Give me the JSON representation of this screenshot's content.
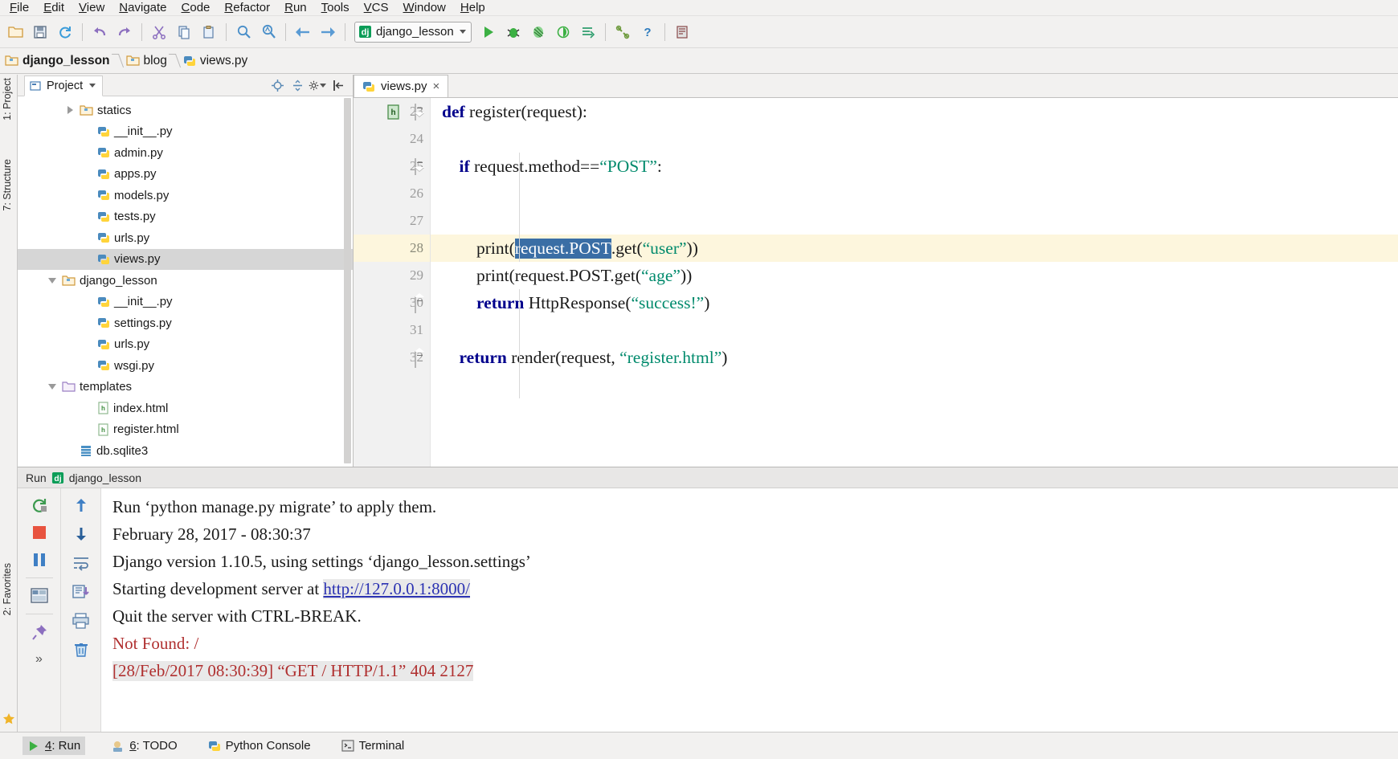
{
  "menu": {
    "items": [
      "File",
      "Edit",
      "View",
      "Navigate",
      "Code",
      "Refactor",
      "Run",
      "Tools",
      "VCS",
      "Window",
      "Help"
    ]
  },
  "toolbar": {
    "buttons": [
      {
        "name": "open-folder-icon",
        "label": "Open"
      },
      {
        "name": "save-all-icon",
        "label": "Save All"
      },
      {
        "name": "sync-icon",
        "label": "Synchronize"
      },
      {
        "name": "undo-icon",
        "label": "Undo"
      },
      {
        "name": "redo-icon",
        "label": "Redo"
      },
      {
        "name": "cut-icon",
        "label": "Cut"
      },
      {
        "name": "copy-icon",
        "label": "Copy"
      },
      {
        "name": "paste-icon",
        "label": "Paste"
      },
      {
        "name": "find-icon",
        "label": "Find"
      },
      {
        "name": "replace-icon",
        "label": "Replace"
      },
      {
        "name": "back-arrow-icon",
        "label": "Back"
      },
      {
        "name": "forward-arrow-icon",
        "label": "Forward"
      }
    ],
    "run_config": "django_lesson",
    "right_buttons": [
      {
        "name": "run-icon",
        "label": "Run"
      },
      {
        "name": "debug-icon",
        "label": "Debug"
      },
      {
        "name": "coverage-icon",
        "label": "Run with Coverage"
      },
      {
        "name": "profile-icon",
        "label": "Profile"
      },
      {
        "name": "attach-icon",
        "label": "Attach to Process"
      },
      {
        "name": "settings-wrench-icon",
        "label": "Settings"
      },
      {
        "name": "help-icon",
        "label": "Help"
      },
      {
        "name": "database-icon",
        "label": "Database"
      }
    ]
  },
  "breadcrumb": {
    "items": [
      {
        "label": "django_lesson",
        "icon": "folder-icon",
        "bold": true
      },
      {
        "label": "blog",
        "icon": "folder-icon",
        "bold": false
      },
      {
        "label": "views.py",
        "icon": "python-file-icon",
        "bold": false
      }
    ]
  },
  "left_rail": {
    "project_label": "1: Project",
    "structure_label": "7: Structure",
    "favorites_label": "2: Favorites"
  },
  "project_panel": {
    "title": "Project",
    "actions": [
      {
        "name": "locate-icon",
        "label": "Select Opened File"
      },
      {
        "name": "collapse-all-icon",
        "label": "Collapse All"
      },
      {
        "name": "gear-icon",
        "label": "Settings"
      },
      {
        "name": "hide-icon",
        "label": "Hide"
      }
    ],
    "tree": [
      {
        "label": "statics",
        "icon": "folder-icon",
        "indent": 2,
        "arrow": "right",
        "selected": false
      },
      {
        "label": "__init__.py",
        "icon": "python-file-icon",
        "indent": 3,
        "arrow": "none",
        "selected": false
      },
      {
        "label": "admin.py",
        "icon": "python-file-icon",
        "indent": 3,
        "arrow": "none",
        "selected": false
      },
      {
        "label": "apps.py",
        "icon": "python-file-icon",
        "indent": 3,
        "arrow": "none",
        "selected": false
      },
      {
        "label": "models.py",
        "icon": "python-file-icon",
        "indent": 3,
        "arrow": "none",
        "selected": false
      },
      {
        "label": "tests.py",
        "icon": "python-file-icon",
        "indent": 3,
        "arrow": "none",
        "selected": false
      },
      {
        "label": "urls.py",
        "icon": "python-file-icon",
        "indent": 3,
        "arrow": "none",
        "selected": false
      },
      {
        "label": "views.py",
        "icon": "python-file-icon",
        "indent": 3,
        "arrow": "none",
        "selected": true
      },
      {
        "label": "django_lesson",
        "icon": "folder-icon",
        "indent": 1,
        "arrow": "down",
        "selected": false
      },
      {
        "label": "__init__.py",
        "icon": "python-file-icon",
        "indent": 3,
        "arrow": "none",
        "selected": false
      },
      {
        "label": "settings.py",
        "icon": "python-file-icon",
        "indent": 3,
        "arrow": "none",
        "selected": false
      },
      {
        "label": "urls.py",
        "icon": "python-file-icon",
        "indent": 3,
        "arrow": "none",
        "selected": false
      },
      {
        "label": "wsgi.py",
        "icon": "python-file-icon",
        "indent": 3,
        "arrow": "none",
        "selected": false
      },
      {
        "label": "templates",
        "icon": "folder-plain-icon",
        "indent": 1,
        "arrow": "down",
        "selected": false
      },
      {
        "label": "index.html",
        "icon": "html-file-icon",
        "indent": 3,
        "arrow": "none",
        "selected": false
      },
      {
        "label": "register.html",
        "icon": "html-file-icon",
        "indent": 3,
        "arrow": "none",
        "selected": false
      },
      {
        "label": "db.sqlite3",
        "icon": "database-file-icon",
        "indent": 2,
        "arrow": "none",
        "selected": false
      }
    ]
  },
  "editor": {
    "tab": {
      "label": "views.py",
      "icon": "python-file-icon",
      "close": "×"
    },
    "lines": [
      {
        "num": "23",
        "fold": "open",
        "icon": "html-gutter-icon",
        "current": false,
        "tokens": [
          {
            "t": "def ",
            "c": "kw"
          },
          {
            "t": "register",
            "c": "fn"
          },
          {
            "t": "(request):",
            "c": "plain"
          }
        ]
      },
      {
        "num": "24",
        "fold": "none",
        "icon": "none",
        "current": false,
        "tokens": []
      },
      {
        "num": "25",
        "fold": "open",
        "icon": "none",
        "current": false,
        "tokens": [
          {
            "t": "    ",
            "c": "plain"
          },
          {
            "t": "if ",
            "c": "kw"
          },
          {
            "t": "request.method==",
            "c": "plain"
          },
          {
            "t": "“POST”",
            "c": "str"
          },
          {
            "t": ":",
            "c": "plain"
          }
        ]
      },
      {
        "num": "26",
        "fold": "none",
        "icon": "none",
        "current": false,
        "tokens": []
      },
      {
        "num": "27",
        "fold": "none",
        "icon": "none",
        "current": false,
        "tokens": []
      },
      {
        "num": "28",
        "fold": "none",
        "icon": "none",
        "current": true,
        "tokens": [
          {
            "t": "        print(",
            "c": "plain"
          },
          {
            "t": "request.POST",
            "c": "sel"
          },
          {
            "t": ".get(",
            "c": "plain"
          },
          {
            "t": "“user”",
            "c": "str"
          },
          {
            "t": "))",
            "c": "plain"
          }
        ]
      },
      {
        "num": "29",
        "fold": "none",
        "icon": "none",
        "current": false,
        "tokens": [
          {
            "t": "        print(request.POST.get(",
            "c": "plain"
          },
          {
            "t": "“age”",
            "c": "str"
          },
          {
            "t": "))",
            "c": "plain"
          }
        ]
      },
      {
        "num": "30",
        "fold": "end",
        "icon": "none",
        "current": false,
        "tokens": [
          {
            "t": "        ",
            "c": "plain"
          },
          {
            "t": "return ",
            "c": "kw"
          },
          {
            "t": "HttpResponse(",
            "c": "plain"
          },
          {
            "t": "“success!”",
            "c": "str"
          },
          {
            "t": ")",
            "c": "plain"
          }
        ]
      },
      {
        "num": "31",
        "fold": "none",
        "icon": "none",
        "current": false,
        "tokens": []
      },
      {
        "num": "32",
        "fold": "end",
        "icon": "none",
        "current": false,
        "tokens": [
          {
            "t": "    ",
            "c": "plain"
          },
          {
            "t": "return ",
            "c": "kw"
          },
          {
            "t": "render(request, ",
            "c": "plain"
          },
          {
            "t": "“register.html”",
            "c": "str"
          },
          {
            "t": ")",
            "c": "plain"
          }
        ]
      }
    ]
  },
  "run_panel": {
    "header_prefix": "Run",
    "header_config": "django_lesson",
    "tools_left": [
      {
        "name": "rerun-icon",
        "label": "Rerun"
      },
      {
        "name": "stop-icon",
        "label": "Stop"
      },
      {
        "name": "pause-icon",
        "label": "Pause Output"
      },
      {
        "name": "layout-icon",
        "label": "Layout"
      },
      {
        "name": "pin-icon",
        "label": "Pin Tab"
      },
      {
        "name": "more-icon",
        "label": "»"
      }
    ],
    "tools_right": [
      {
        "name": "arrow-up-icon",
        "label": "Up the Stack Trace"
      },
      {
        "name": "arrow-down-icon",
        "label": "Down the Stack Trace"
      },
      {
        "name": "soft-wrap-icon",
        "label": "Use Soft Wraps"
      },
      {
        "name": "scroll-end-icon",
        "label": "Scroll to End"
      },
      {
        "name": "print-icon",
        "label": "Print"
      },
      {
        "name": "trash-icon",
        "label": "Clear All"
      }
    ],
    "console": [
      {
        "segments": [
          {
            "t": "Run ‘python manage.py migrate’ to apply them.",
            "c": "plain"
          }
        ]
      },
      {
        "segments": [
          {
            "t": "February 28, 2017 - 08:30:37",
            "c": "plain"
          }
        ]
      },
      {
        "segments": [
          {
            "t": "Django version 1.10.5, using settings ‘django_lesson.settings’",
            "c": "plain"
          }
        ]
      },
      {
        "segments": [
          {
            "t": "Starting development server at ",
            "c": "plain"
          },
          {
            "t": "http://127.0.0.1:8000/",
            "c": "link"
          }
        ]
      },
      {
        "segments": [
          {
            "t": "Quit the server with CTRL-BREAK.",
            "c": "plain"
          }
        ]
      },
      {
        "segments": [
          {
            "t": "Not Found: /",
            "c": "red"
          }
        ]
      },
      {
        "segments": [
          {
            "t": "[28/Feb/2017 08:30:39] “GET / HTTP/1.1” 404 2127",
            "c": "red-hl"
          }
        ]
      }
    ]
  },
  "statusbar": {
    "items": [
      {
        "label": "4: Run",
        "icon": "run-small-icon",
        "active": true,
        "underline": "4"
      },
      {
        "label": "6: TODO",
        "icon": "todo-icon",
        "active": false,
        "underline": "6"
      },
      {
        "label": "Python Console",
        "icon": "python-console-icon",
        "active": false,
        "underline": ""
      },
      {
        "label": "Terminal",
        "icon": "terminal-icon",
        "active": false,
        "underline": ""
      }
    ]
  }
}
